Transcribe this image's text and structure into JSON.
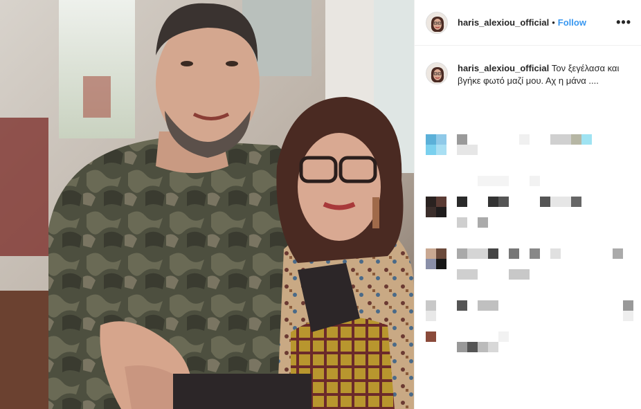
{
  "post": {
    "username": "haris_alexiou_official",
    "separator": "•",
    "follow_label": "Follow",
    "more_icon": "more-options-icon",
    "more_glyph": "•••"
  },
  "caption": {
    "username": "haris_alexiou_official",
    "text": "Τον ξεγέλασα και βγήκε φωτό μαζί μου. Αχ η μάνα ...."
  }
}
